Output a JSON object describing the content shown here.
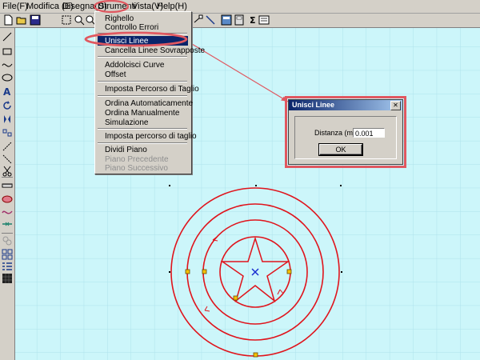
{
  "menubar": {
    "items": [
      "File(F)",
      "Modifica (E)",
      "Disegna(D)",
      "Strumenti",
      "Vista(V)",
      "Help(H)"
    ]
  },
  "dropdown": {
    "items": [
      "Righello",
      "Controllo Errori",
      "Unisci Linee",
      "Cancella Linee Sovrapposte",
      "Addolcisci Curve",
      "Offset",
      "Imposta Percorso di Taglio",
      "Ordina Automaticamente",
      "Ordina Manualmente",
      "Simulazione",
      "Imposta percorso di taglio",
      "Dividi Piano",
      "Piano Precedente",
      "Piano Successivo"
    ],
    "selected": "Unisci Linee",
    "disabled": [
      "Piano Precedente",
      "Piano Successivo"
    ]
  },
  "dialog": {
    "title": "Unisci Linee",
    "close": "✕",
    "field_label": "Distanza (mm):",
    "field_value": "0.001",
    "ok_label": "OK"
  },
  "colors": {
    "canvas_bg": "#ccf6fa",
    "grid": "#aee2ec",
    "shape": "#e0141c",
    "highlight": "#0a246a",
    "annotation": "#e05860"
  },
  "toolbar": {
    "icons": [
      "new-icon",
      "open-icon",
      "save-icon",
      "select-icon",
      "zoom-icon",
      "zoom-window-icon",
      "node-icon",
      "line-tool-icon",
      "image-icon",
      "calculator-icon",
      "sum-icon",
      "text-icon"
    ]
  },
  "left_toolbar": {
    "icons": [
      "line-icon",
      "rectangle-icon",
      "curve-icon",
      "ellipse-icon",
      "text-icon",
      "rotate-icon",
      "mirror-icon",
      "array-icon",
      "node-edit-icon",
      "scissors-icon",
      "ruler-icon",
      "lens-icon",
      "wave-icon",
      "join-icon",
      "link-icon",
      "grid-icon",
      "list-icon",
      "fill-icon"
    ]
  }
}
